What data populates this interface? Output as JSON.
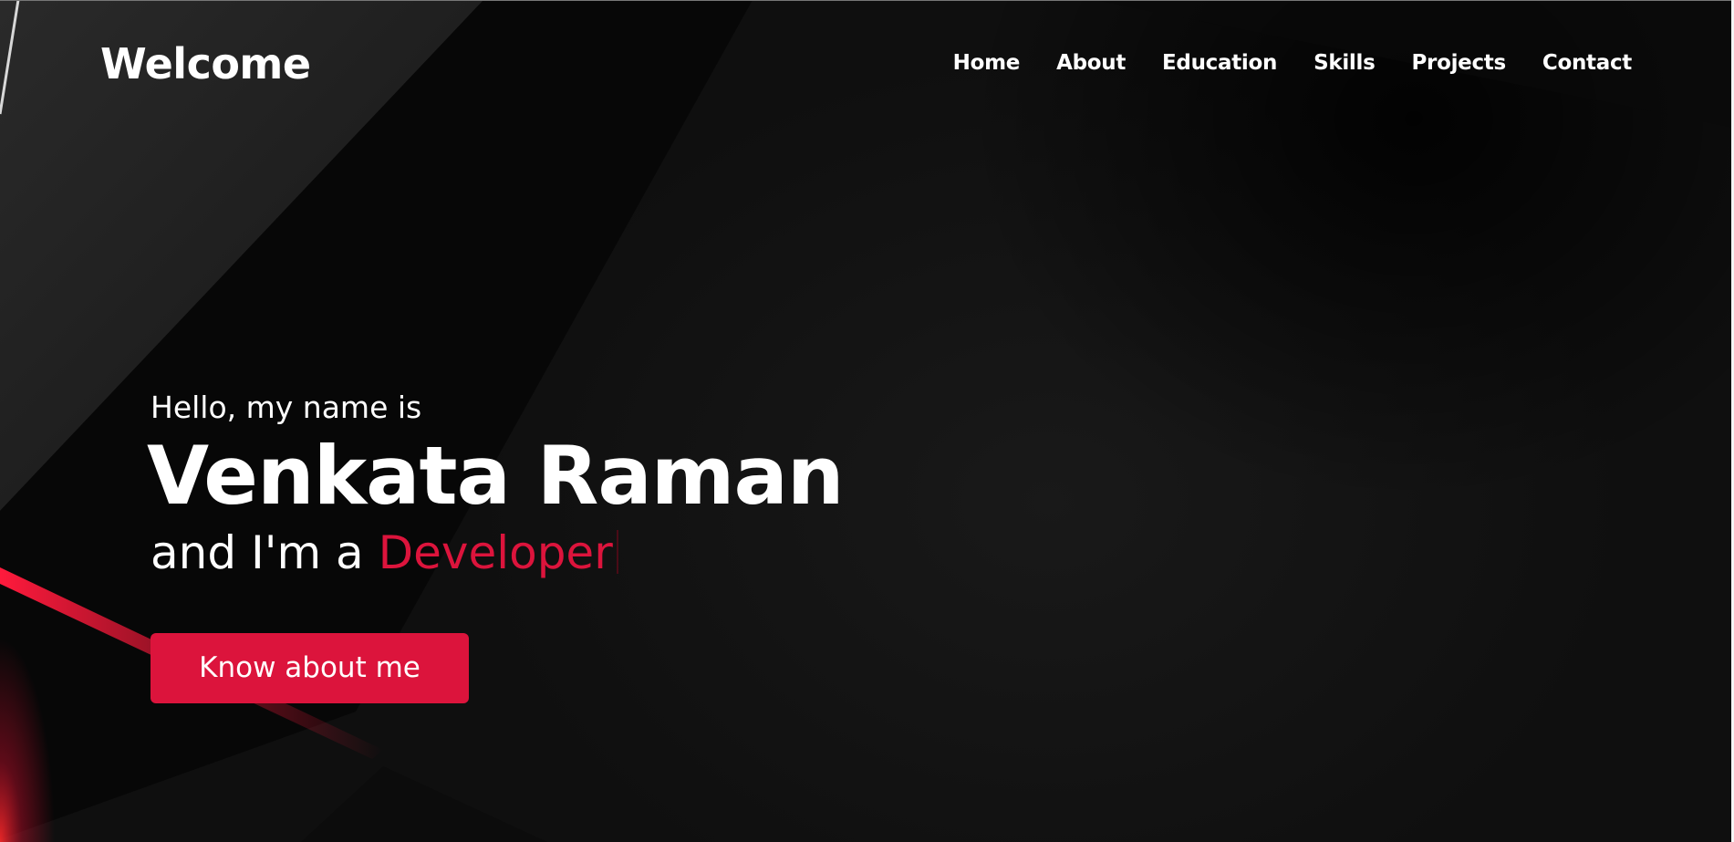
{
  "brand": {
    "logo_text": "Welcome"
  },
  "nav": {
    "items": [
      {
        "label": "Home"
      },
      {
        "label": "About"
      },
      {
        "label": "Education"
      },
      {
        "label": "Skills"
      },
      {
        "label": "Projects"
      },
      {
        "label": "Contact"
      }
    ]
  },
  "hero": {
    "greeting": "Hello, my name is",
    "name": "Venkata Raman",
    "role_prefix": "and I'm a ",
    "role": "Developer",
    "button_label": "Know about me"
  },
  "colors": {
    "accent": "#dc143c",
    "background": "#0d0d0d",
    "text": "#ffffff"
  }
}
